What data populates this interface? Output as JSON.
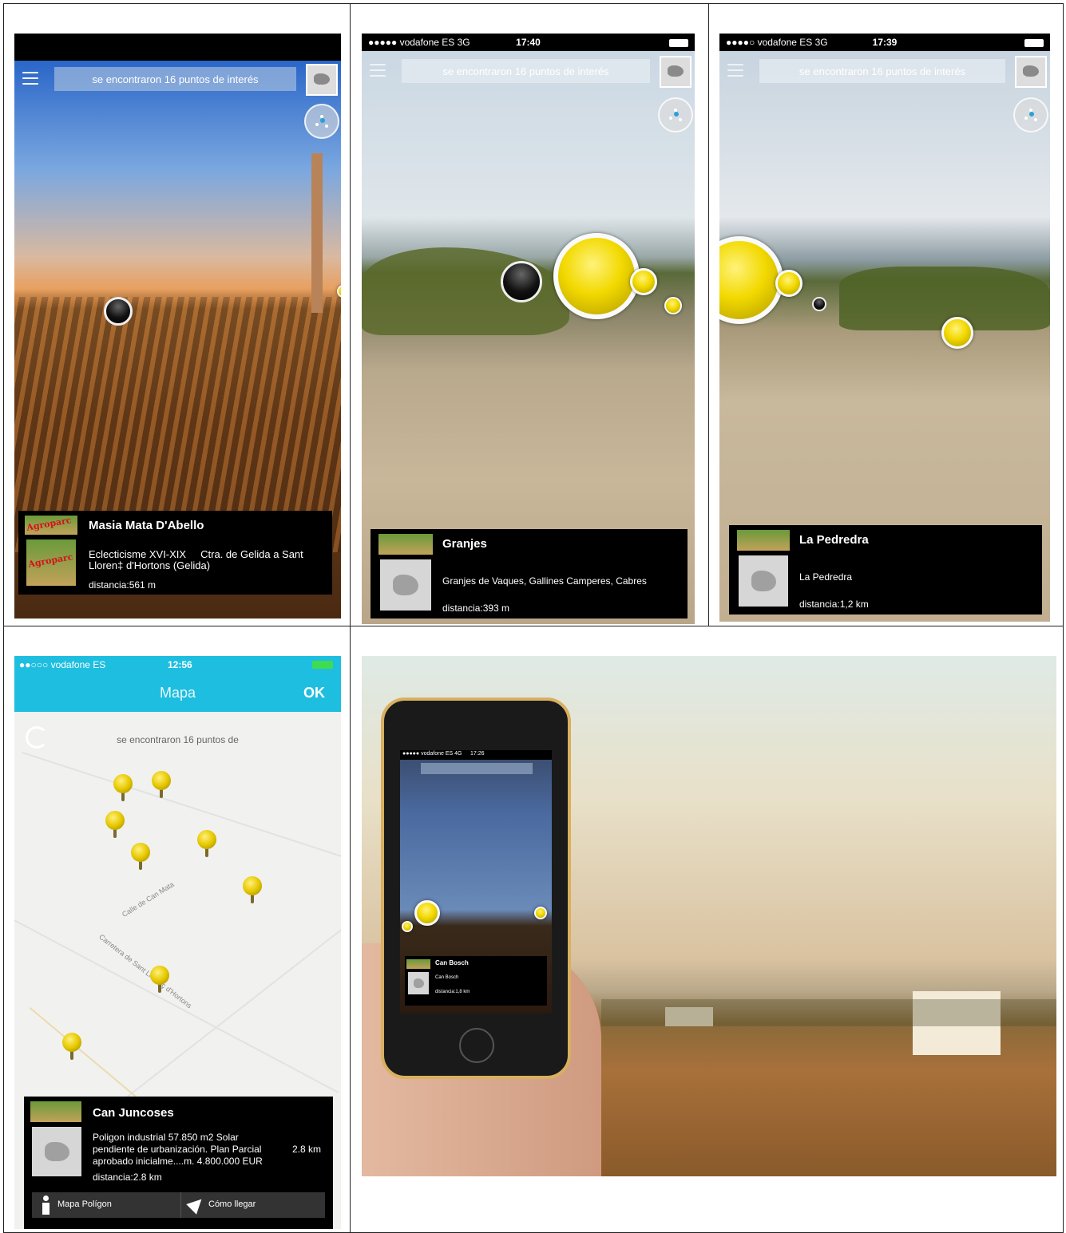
{
  "panel_a": {
    "search_text": "se encontraron 16 puntos de interés",
    "info": {
      "logo_text": "Agroparc",
      "title": "Masia Mata D'Abello",
      "desc_1": "Eclecticisme XVI-XIX     Ctra. de Gelida a Sant",
      "desc_2": "Lloren‡ d'Hortons  (Gelida)",
      "distance": "distancia:561 m"
    }
  },
  "panel_b": {
    "status": {
      "carrier": "●●●●● vodafone ES  3G",
      "time": "17:40"
    },
    "search_text": "se encontraron 16 puntos de interés",
    "info": {
      "title": "Granjes",
      "desc": "Granjes de Vaques, Gallines Camperes, Cabres",
      "distance": "distancia:393 m"
    }
  },
  "panel_c": {
    "status": {
      "carrier": "●●●●○ vodafone ES  3G",
      "time": "17:39"
    },
    "search_text": "se encontraron 16 puntos de interés",
    "info": {
      "title": "La Pedredra",
      "desc": "La Pedredra",
      "distance": "distancia:1,2 km"
    }
  },
  "panel_d": {
    "status": {
      "carrier": "●●○○○ vodafone ES",
      "time": "12:56"
    },
    "nav": {
      "title": "Mapa",
      "ok": "OK"
    },
    "search_text": "se encontraron 16 puntos de",
    "streets": [
      "Calle de Can Mata",
      "Carretera de Sant Llorenç d'Hortons"
    ],
    "info": {
      "title": "Can Juncoses",
      "desc_1": "Poligon industrial 57.850 m2 Solar",
      "desc_2": "pendiente de urbanización. Plan Parcial",
      "desc_3": "aprobado inicialme....m. 4.800.000 EUR",
      "side_distance": "2.8 km",
      "distance": "distancia:2.8 km",
      "btn_map": "Mapa Polígon",
      "btn_route": "Cómo llegar"
    }
  },
  "panel_e": {
    "phone": {
      "carrier": "●●●●● vodafone ES  4G",
      "time": "17:26",
      "title": "Can Bosch",
      "desc": "Can Bosch",
      "distance": "distancia:1,8 km"
    }
  },
  "colors": {
    "teal_nav": "#1ebee0",
    "poi_yellow": "#f2d900",
    "panel_black": "#000000"
  }
}
